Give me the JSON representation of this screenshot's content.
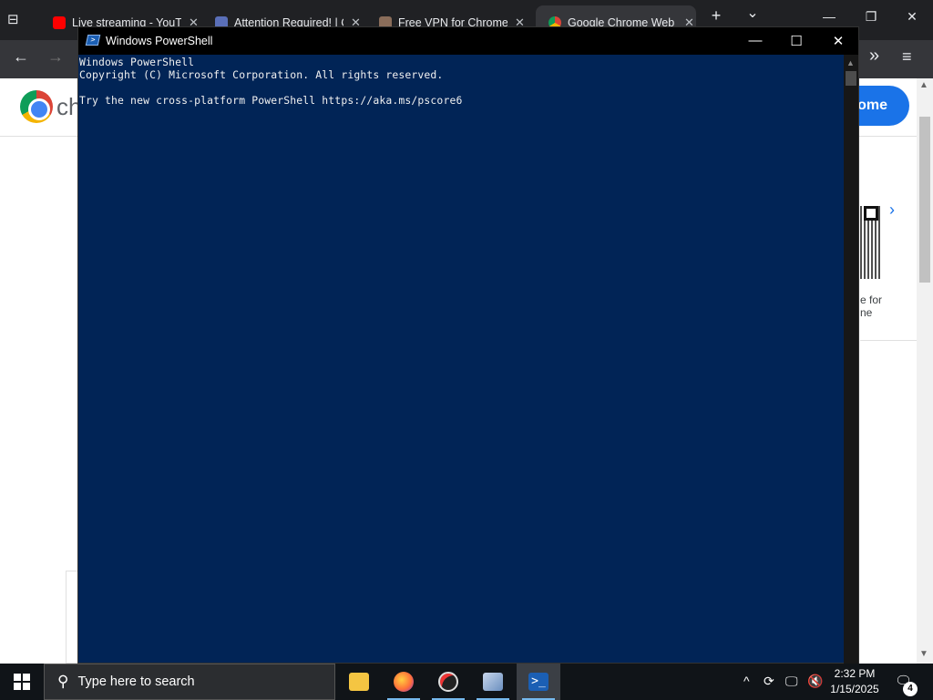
{
  "browser": {
    "tabs": [
      {
        "title": "Live streaming - YouTube",
        "favicon_color": "#ff0000",
        "close": "✕"
      },
      {
        "title": "Attention Required! | Cloudflare",
        "favicon_color": "#5a6fb8",
        "close": "✕"
      },
      {
        "title": "Free VPN for Chrome -",
        "favicon_color": "#8a6d5a",
        "close": "✕"
      },
      {
        "title": "Google Chrome Web Store",
        "favicon_color": "#4285f4",
        "close": "✕"
      }
    ],
    "new_tab": "+",
    "tab_list": "⌄",
    "page": {
      "logo_text": "ch",
      "add_button": "ome",
      "card_text": "e for\nne"
    }
  },
  "powershell": {
    "title": "Windows PowerShell",
    "console_lines": [
      "Windows PowerShell",
      "Copyright (C) Microsoft Corporation. All rights reserved.",
      "",
      "Try the new cross-platform PowerShell https://aka.ms/pscore6"
    ],
    "background_color": "#012456"
  },
  "taskbar": {
    "search_placeholder": "Type here to search",
    "apps": [
      {
        "name": "file-explorer",
        "color": "#f4c542"
      },
      {
        "name": "firefox",
        "color": "#ff7139"
      },
      {
        "name": "app-3",
        "color": "#444"
      },
      {
        "name": "app-4",
        "color": "#6a8fbf"
      },
      {
        "name": "powershell",
        "color": "#1b5fb4"
      }
    ],
    "time": "2:32 PM",
    "date": "1/15/2025",
    "notification_count": "4"
  }
}
